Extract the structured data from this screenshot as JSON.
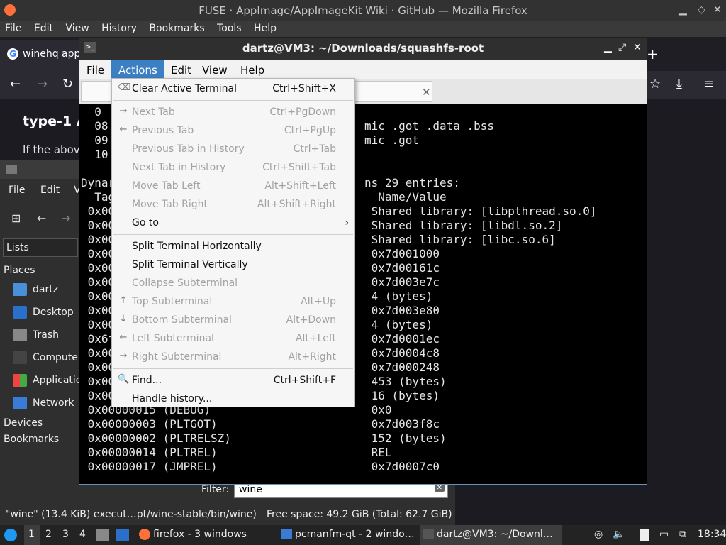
{
  "firefox": {
    "window_title": "FUSE · AppImage/AppImageKit Wiki · GitHub — Mozilla Firefox",
    "menu": [
      "File",
      "Edit",
      "View",
      "History",
      "Bookmarks",
      "Tools",
      "Help"
    ],
    "tab_label": "winehq app",
    "heading": "type-1 A",
    "paragraph": "If the above"
  },
  "filemanager": {
    "menu": [
      "File",
      "Edit",
      "V"
    ],
    "lists_label": "Lists",
    "places_header": "Places",
    "places": [
      "dartz",
      "Desktop",
      "Trash",
      "Compute",
      "Applicatio",
      "Network"
    ],
    "devices": "Devices",
    "bookmarks": "Bookmarks",
    "filter_label": "Filter:",
    "filter_value": "wine",
    "status_left": "\"wine\" (13.4 KiB) execut…pt/wine-stable/bin/wine)",
    "status_right": "Free space: 49.2 GiB (Total: 62.7 GiB)"
  },
  "terminal": {
    "title": "dartz@VM3: ~/Downloads/squashfs-root",
    "menu": [
      "File",
      "Actions",
      "Edit",
      "View",
      "Help"
    ],
    "lines_left": [
      "  0",
      "  08",
      "  09",
      "  10",
      "",
      "Dynar",
      "  Tag",
      " 0x00",
      " 0x00",
      " 0x00",
      " 0x00",
      " 0x00",
      " 0x00",
      " 0x00",
      " 0x00",
      " 0x00",
      " 0x6f",
      " 0x00",
      " 0x00",
      " 0x00",
      " 0x00",
      " 0x00000015 (DEBUG)",
      " 0x00000003 (PLTGOT)",
      " 0x00000002 (PLTRELSZ)",
      " 0x00000014 (PLTREL)",
      " 0x00000017 (JMPREL)"
    ],
    "lines_right": [
      "",
      "mic .got .data .bss",
      "mic .got",
      "",
      "",
      "ns 29 entries:",
      "  Name/Value",
      " Shared library: [libpthread.so.0]",
      " Shared library: [libdl.so.2]",
      " Shared library: [libc.so.6]",
      " 0x7d001000",
      " 0x7d00161c",
      " 0x7d003e7c",
      " 4 (bytes)",
      " 0x7d003e80",
      " 4 (bytes)",
      " 0x7d0001ec",
      " 0x7d0004c8",
      " 0x7d000248",
      " 453 (bytes)",
      " 16 (bytes)",
      " 0x0",
      " 0x7d003f8c",
      " 152 (bytes)",
      " REL",
      " 0x7d0007c0"
    ]
  },
  "actions_menu": {
    "items": [
      {
        "label": "Clear Active Terminal",
        "shortcut": "Ctrl+Shift+X",
        "icon": "clear-icon",
        "glyph": "⌫",
        "enabled": true
      },
      {
        "sep": true
      },
      {
        "label": "Next Tab",
        "shortcut": "Ctrl+PgDown",
        "icon": "arrow-right-icon",
        "glyph": "→",
        "enabled": false
      },
      {
        "label": "Previous Tab",
        "shortcut": "Ctrl+PgUp",
        "icon": "arrow-left-icon",
        "glyph": "←",
        "enabled": false
      },
      {
        "label": "Previous Tab in History",
        "shortcut": "Ctrl+Tab",
        "icon": "",
        "glyph": "",
        "enabled": false
      },
      {
        "label": "Next Tab in History",
        "shortcut": "Ctrl+Shift+Tab",
        "icon": "",
        "glyph": "",
        "enabled": false
      },
      {
        "label": "Move Tab Left",
        "shortcut": "Alt+Shift+Left",
        "icon": "",
        "glyph": "",
        "enabled": false
      },
      {
        "label": "Move Tab Right",
        "shortcut": "Alt+Shift+Right",
        "icon": "",
        "glyph": "",
        "enabled": false
      },
      {
        "label": "Go to",
        "shortcut": "›",
        "icon": "",
        "glyph": "",
        "enabled": true
      },
      {
        "sep": true
      },
      {
        "label": "Split Terminal Horizontally",
        "shortcut": "",
        "icon": "",
        "glyph": "",
        "enabled": true
      },
      {
        "label": "Split Terminal Vertically",
        "shortcut": "",
        "icon": "",
        "glyph": "",
        "enabled": true
      },
      {
        "label": "Collapse Subterminal",
        "shortcut": "",
        "icon": "",
        "glyph": "",
        "enabled": false
      },
      {
        "label": "Top Subterminal",
        "shortcut": "Alt+Up",
        "icon": "arrow-up-icon",
        "glyph": "↑",
        "enabled": false
      },
      {
        "label": "Bottom Subterminal",
        "shortcut": "Alt+Down",
        "icon": "arrow-down-icon",
        "glyph": "↓",
        "enabled": false
      },
      {
        "label": "Left Subterminal",
        "shortcut": "Alt+Left",
        "icon": "arrow-left-icon",
        "glyph": "←",
        "enabled": false
      },
      {
        "label": "Right Subterminal",
        "shortcut": "Alt+Right",
        "icon": "arrow-right-icon",
        "glyph": "→",
        "enabled": false
      },
      {
        "sep": true
      },
      {
        "label": "Find...",
        "shortcut": "Ctrl+Shift+F",
        "icon": "search-icon",
        "glyph": "🔍",
        "enabled": true
      },
      {
        "label": "Handle history...",
        "shortcut": "",
        "icon": "",
        "glyph": "",
        "enabled": true
      }
    ]
  },
  "taskbar": {
    "workspaces": [
      "1",
      "2",
      "3",
      "4"
    ],
    "tasks": [
      "firefox - 3 windows",
      "pcmanfm-qt - 2 windo…",
      "dartz@VM3: ~/Downl…"
    ],
    "clock": "18:34"
  },
  "colors": {
    "menu_highlight": "#3c7fc3",
    "terminal_bg": "#000000",
    "disabled_text": "#a2a2a2"
  }
}
